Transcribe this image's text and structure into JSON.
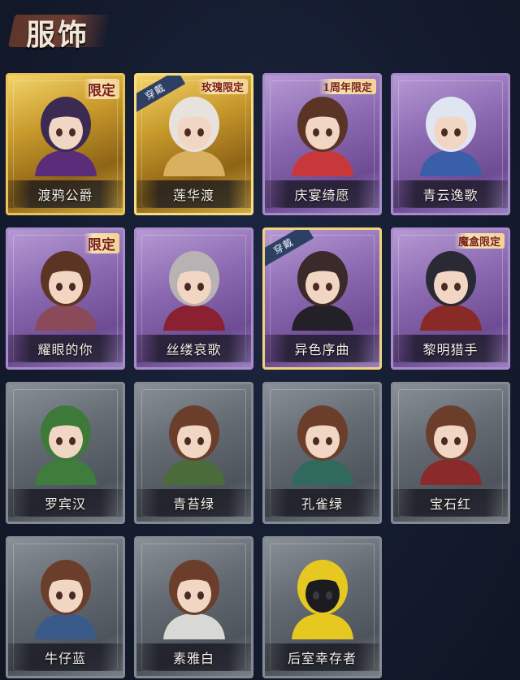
{
  "page": {
    "title": "服饰"
  },
  "equipped_label": "穿戴",
  "costumes": [
    {
      "name": "渡鸦公爵",
      "rarity": "gold",
      "badge": "限定",
      "equipped": false,
      "hair": "#3b2a52",
      "outfit": "#5b2c7a"
    },
    {
      "name": "莲华渡",
      "rarity": "gold",
      "badge": "玫瑰限定",
      "equipped": true,
      "hair": "#e8e2dc",
      "outfit": "#d8b060"
    },
    {
      "name": "庆宴绮愿",
      "rarity": "purple",
      "badge": "1周年限定",
      "equipped": false,
      "hair": "#5a3424",
      "outfit": "#c8383a"
    },
    {
      "name": "青云逸歌",
      "rarity": "purple",
      "badge": "",
      "equipped": false,
      "hair": "#dfe6f2",
      "outfit": "#3a5fa8"
    },
    {
      "name": "耀眼的你",
      "rarity": "purple",
      "badge": "限定",
      "equipped": false,
      "hair": "#5b3424",
      "outfit": "#8a4a5a"
    },
    {
      "name": "丝缕哀歌",
      "rarity": "purple",
      "badge": "",
      "equipped": false,
      "hair": "#b8b2b4",
      "outfit": "#8a2030"
    },
    {
      "name": "异色序曲",
      "rarity": "purple",
      "badge": "",
      "equipped": true,
      "hair": "#3a2a2a",
      "outfit": "#242028"
    },
    {
      "name": "黎明猎手",
      "rarity": "purple",
      "badge": "魔盒限定",
      "equipped": false,
      "hair": "#2a2a34",
      "outfit": "#8a2a26"
    },
    {
      "name": "罗宾汉",
      "rarity": "gray",
      "badge": "",
      "equipped": false,
      "hair": "#3d7a3a",
      "outfit": "#3f7d3c"
    },
    {
      "name": "青苔绿",
      "rarity": "gray",
      "badge": "",
      "equipped": false,
      "hair": "#6a3e2a",
      "outfit": "#4b6b3a"
    },
    {
      "name": "孔雀绿",
      "rarity": "gray",
      "badge": "",
      "equipped": false,
      "hair": "#6a3e2a",
      "outfit": "#2f6a5c"
    },
    {
      "name": "宝石红",
      "rarity": "gray",
      "badge": "",
      "equipped": false,
      "hair": "#6a3e2a",
      "outfit": "#8a2a2a"
    },
    {
      "name": "牛仔蓝",
      "rarity": "gray",
      "badge": "",
      "equipped": false,
      "hair": "#6a3e2a",
      "outfit": "#3a5a8a"
    },
    {
      "name": "素雅白",
      "rarity": "gray",
      "badge": "",
      "equipped": false,
      "hair": "#6a3e2a",
      "outfit": "#d8d8d4"
    },
    {
      "name": "后室幸存者",
      "rarity": "gray",
      "badge": "",
      "equipped": false,
      "hair": "#e6c820",
      "outfit": "#e6c820"
    }
  ]
}
